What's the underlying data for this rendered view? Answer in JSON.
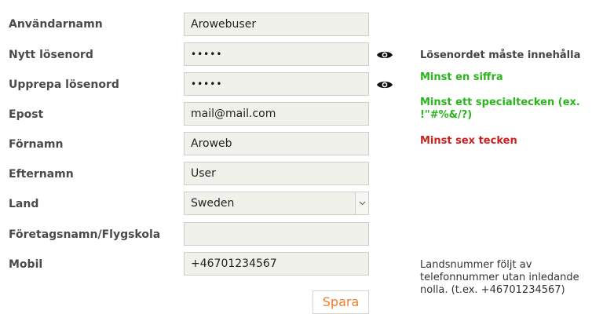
{
  "form": {
    "username": {
      "label": "Användarnamn",
      "value": "Arowebuser"
    },
    "new_password": {
      "label": "Nytt lösenord",
      "value": "•••••"
    },
    "repeat_password": {
      "label": "Upprepa lösenord",
      "value": "•••••"
    },
    "email": {
      "label": "Epost",
      "value": "mail@mail.com"
    },
    "first_name": {
      "label": "Förnamn",
      "value": "Aroweb"
    },
    "last_name": {
      "label": "Efternamn",
      "value": "User"
    },
    "country": {
      "label": "Land",
      "value": "Sweden"
    },
    "company": {
      "label": "Företagsnamn/Flygskola",
      "value": ""
    },
    "mobile": {
      "label": "Mobil",
      "value": "+46701234567"
    },
    "save_label": "Spara"
  },
  "password_rules": {
    "heading": "Lösenordet måste innehålla",
    "rules": [
      {
        "text": "Minst en siffra",
        "status": "ok",
        "color": "#2bb51d"
      },
      {
        "text": "Minst ett specialtecken (ex. !\"#%&/?)",
        "status": "ok",
        "color": "#2bb51d"
      },
      {
        "text": "Minst sex tecken",
        "status": "fail",
        "color": "#cc1f1f"
      }
    ]
  },
  "mobile_note": "Landsnummer följt av telefonnummer utan inledande nolla. (t.ex. +46701234567)",
  "icons": {
    "password_toggle": "eye-icon",
    "select_arrow": "chevron-down-icon"
  },
  "colors": {
    "field_background": "#f1f1ec",
    "save_text": "#ef7d2a",
    "rule_ok": "#2bb51d",
    "rule_fail": "#cc1f1f"
  }
}
